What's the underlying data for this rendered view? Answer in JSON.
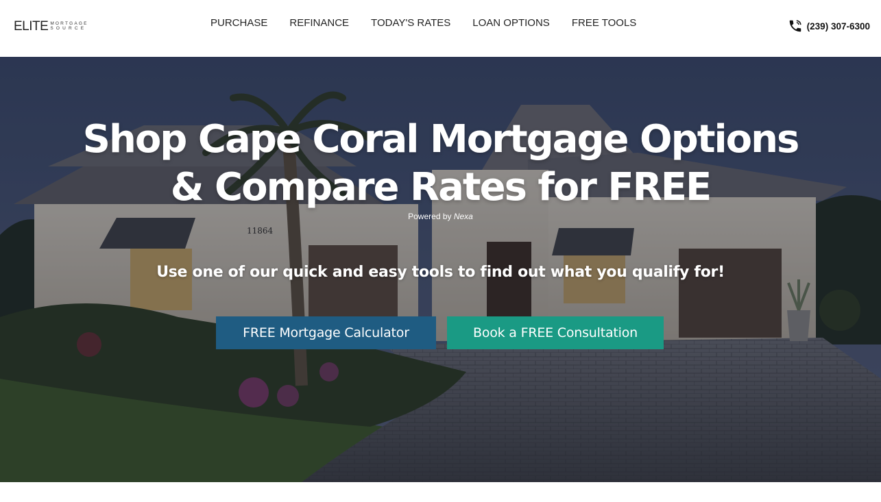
{
  "logo": {
    "main": "ELITE",
    "sub_top": "MORTGAGE",
    "sub_bottom": "SOURCE"
  },
  "nav": {
    "items": [
      {
        "label": "PURCHASE"
      },
      {
        "label": "REFINANCE"
      },
      {
        "label": "TODAY'S RATES"
      },
      {
        "label": "LOAN OPTIONS"
      },
      {
        "label": "FREE TOOLS"
      }
    ]
  },
  "phone": {
    "icon": "phone-icon",
    "number": "(239) 307-6300"
  },
  "hero": {
    "title_line1": "Shop Cape Coral Mortgage Options",
    "title_line2": "& Compare Rates for FREE",
    "powered_prefix": "Powered by",
    "powered_brand": "Nexa",
    "subtitle": "Use one of our quick and easy tools to find out what you qualify for!",
    "house_number": "11864",
    "buttons": {
      "calculator": "FREE Mortgage Calculator",
      "consultation": "Book a FREE Consultation"
    }
  },
  "colors": {
    "calculator_button": "#1f5c82",
    "consultation_button": "#1a9a84",
    "header_bg": "#ffffff",
    "text_dark": "#222222"
  }
}
